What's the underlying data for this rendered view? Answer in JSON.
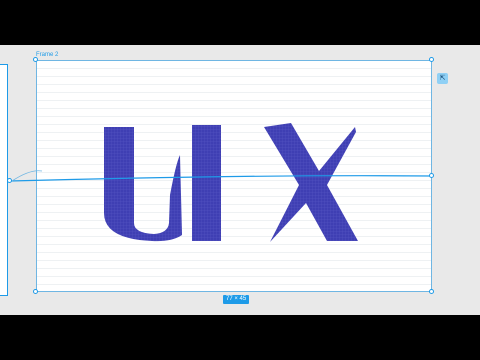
{
  "frame": {
    "label": "Frame 2",
    "size_label": "77 × 45"
  },
  "logo_text": "UIX",
  "colors": {
    "canvas_bg": "#e9e9e9",
    "selection": "#1e9be8",
    "letters": "#3f3fb3"
  },
  "icons": {
    "corner_tool": "expand-arrow-icon"
  }
}
